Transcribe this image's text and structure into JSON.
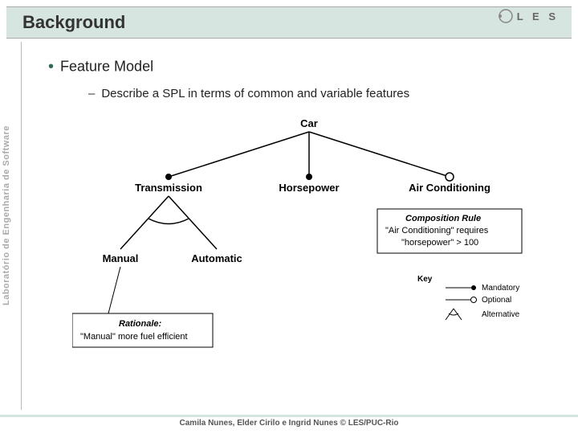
{
  "header": {
    "title": "Background"
  },
  "logo": {
    "text": "L E S"
  },
  "sidebar": {
    "text": "Laboratório de Engenharia de Software"
  },
  "content": {
    "bullet1": "Feature Model",
    "bullet2": "Describe a SPL in terms of common and variable features"
  },
  "diagram": {
    "root": "Car",
    "children": [
      "Transmission",
      "Horsepower",
      "Air Conditioning"
    ],
    "transmission_children": [
      "Manual",
      "Automatic"
    ],
    "rationale_title": "Rationale:",
    "rationale_body": "\"Manual\" more fuel efficient",
    "comprule_title": "Composition Rule",
    "comprule_l1": "\"Air Conditioning\" requires",
    "comprule_l2": "\"horsepower\" > 100",
    "key_title": "Key",
    "key_items": [
      "Mandatory",
      "Optional",
      "Alternative"
    ]
  },
  "footer": {
    "text": "Camila Nunes, Elder Cirilo e Ingrid Nunes © LES/PUC-Rio"
  }
}
